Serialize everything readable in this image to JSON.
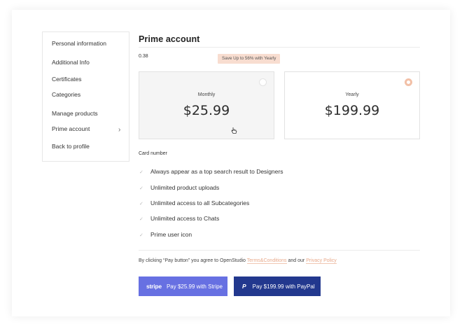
{
  "sidebar": {
    "items": [
      {
        "label": "Personal information"
      },
      {
        "label": "Additional Info"
      },
      {
        "label": "Certificates"
      },
      {
        "label": "Categories"
      },
      {
        "label": "Manage products"
      },
      {
        "label": "Prime account"
      },
      {
        "label": "Back to profile"
      }
    ],
    "chevron_icon": "chevron-right-icon"
  },
  "main": {
    "title": "Prime account",
    "small_value": "0.38",
    "save_badge": "Save Up  to 56% with Yearly",
    "plans": [
      {
        "label": "Monthly",
        "price": "$25.99",
        "selected": false
      },
      {
        "label": "Yearly",
        "price": "$199.99",
        "selected": true
      }
    ],
    "card_number_label": "Card number",
    "features": [
      "Always appear as a top search result to Designers",
      "Unlimited product uploads",
      "Unlimited access to all Subcategories",
      "Unlimited access to Chats",
      "Prime user icon"
    ],
    "agreement": {
      "prefix": "By clicking “Pay button” you agree to OpenStudio",
      "terms_link": "Terms&Conditions",
      "middle": "and our",
      "privacy_link": "Privacy Policy"
    },
    "buttons": {
      "stripe_logo": "stripe",
      "stripe_label": "Pay $25.99 with Stripe",
      "paypal_label": "Pay $199.99 with PayPal"
    }
  },
  "colors": {
    "accent": "#e8a98a",
    "stripe": "#6770e2",
    "paypal": "#22388e",
    "badge_bg": "#f8ddd0"
  }
}
